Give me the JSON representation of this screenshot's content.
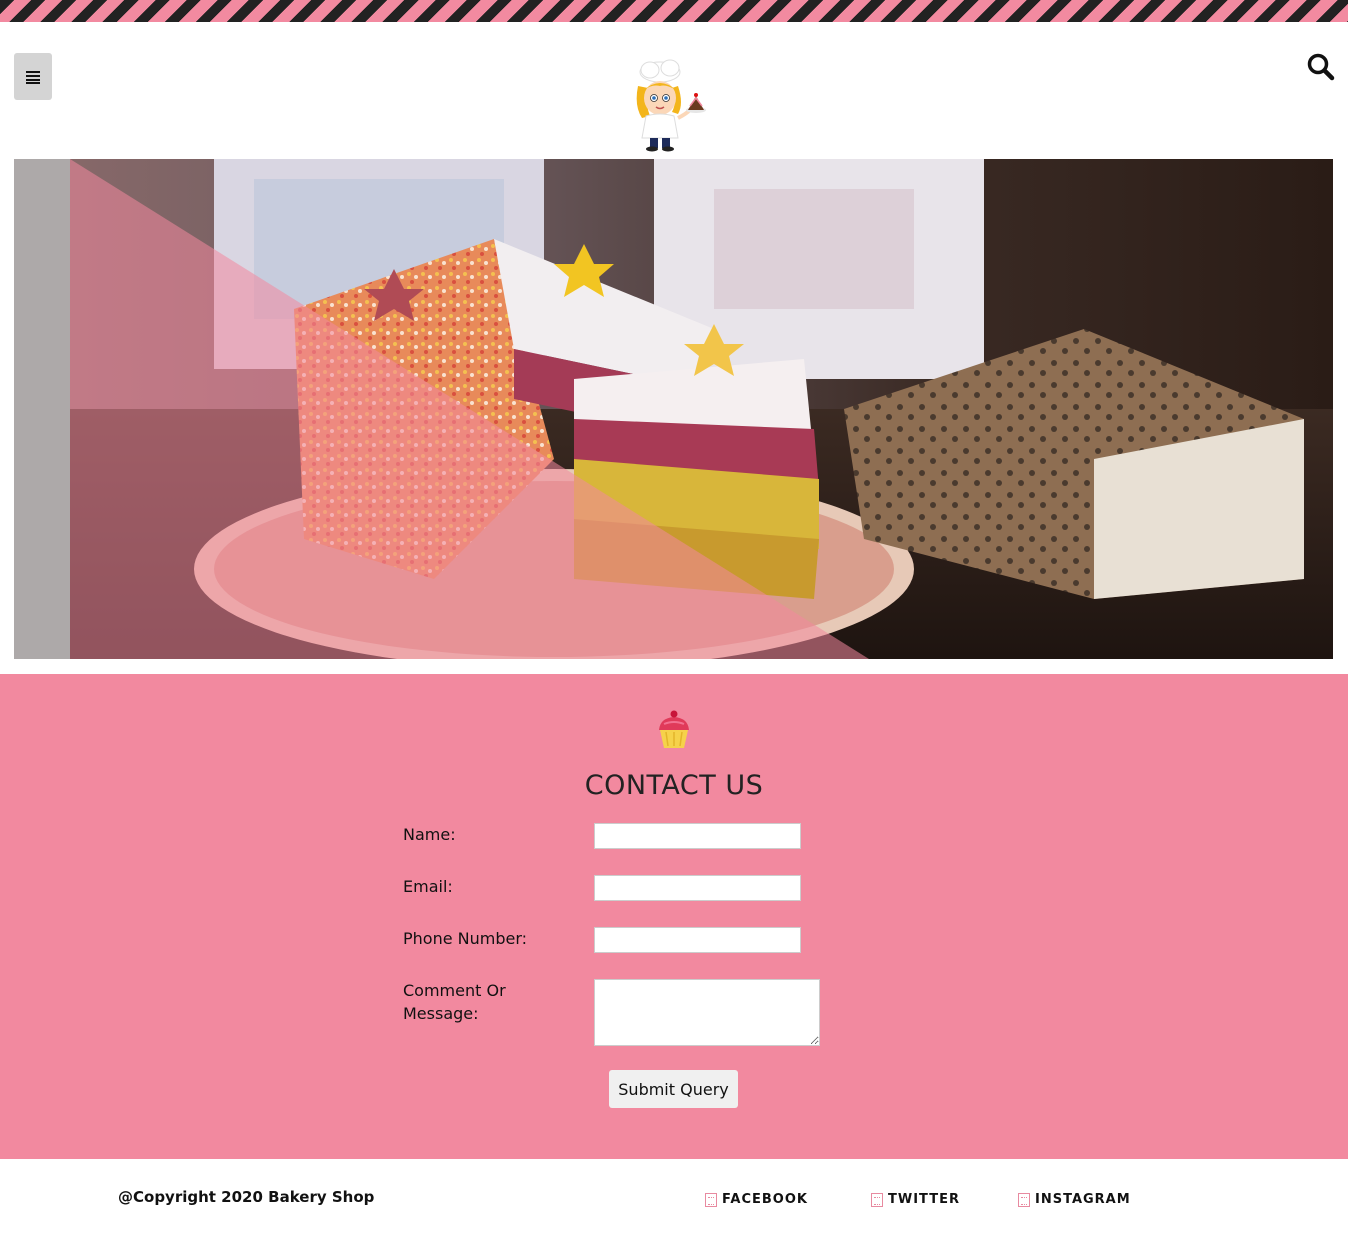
{
  "header": {
    "menu_icon": "hamburger-menu-icon",
    "search_icon": "search-icon",
    "logo": "chef-girl-mascot-logo"
  },
  "hero": {
    "image": "rainbow-layer-cake-slices-photo"
  },
  "contact": {
    "icon": "cupcake-icon",
    "title": "CONTACT US",
    "fields": {
      "name_label": "Name:",
      "email_label": "Email:",
      "phone_label": "Phone Number:",
      "message_label_line1": "Comment Or",
      "message_label_line2": "Message:"
    },
    "submit_label": "Submit Query"
  },
  "footer": {
    "copyright": "@Copyright 2020 Bakery Shop",
    "social": {
      "facebook": "FACEBOOK",
      "twitter": "TWITTER",
      "instagram": "INSTAGRAM"
    }
  },
  "colors": {
    "accent_pink": "#f2899f",
    "stripe_dark": "#222222"
  }
}
